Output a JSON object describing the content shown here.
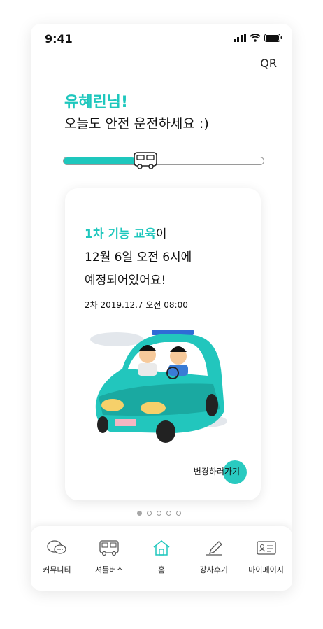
{
  "status_bar": {
    "time": "9:41"
  },
  "header": {
    "qr_label": "QR"
  },
  "greeting": {
    "name": "유혜린님!",
    "message": "오늘도 안전 운전하세요 :)"
  },
  "progress": {
    "fraction": 0.36
  },
  "card": {
    "title_accent": "1차 기능 교육",
    "title_suffix": "이",
    "title_line2": "12월 6일 오전 6시에",
    "title_line3": "예정되어있어요!",
    "next_schedule": "2차 2019.12.7 오전 08:00",
    "change_label": "변경하러가기"
  },
  "pager": {
    "count": 5,
    "active": 0
  },
  "tabbar": {
    "tabs": [
      {
        "label": "커뮤니티",
        "icon": "chat-icon"
      },
      {
        "label": "셔틀버스",
        "icon": "bus-icon"
      },
      {
        "label": "홈",
        "icon": "home-icon",
        "active": true
      },
      {
        "label": "강사후기",
        "icon": "pencil-icon"
      },
      {
        "label": "마이페이지",
        "icon": "id-card-icon"
      }
    ]
  },
  "colors": {
    "accent": "#1ec7bd",
    "car_body": "#22c6bd",
    "headlight": "#f6d06a"
  }
}
